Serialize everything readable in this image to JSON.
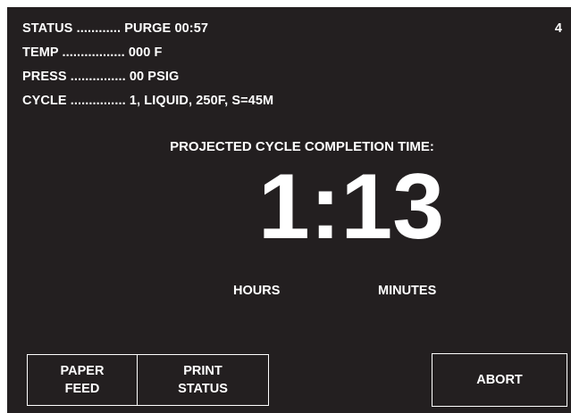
{
  "status_lines": {
    "status": "STATUS ............ PURGE 00:57",
    "temp": "TEMP ................. 000 F",
    "press": "PRESS ............... 00 PSIG",
    "cycle": "CYCLE ............... 1, LIQUID, 250F, S=45M"
  },
  "page_indicator": "4",
  "projection": {
    "label": "PROJECTED CYCLE COMPLETION TIME:",
    "time": "1:13",
    "hours_label": "HOURS",
    "minutes_label": "MINUTES"
  },
  "buttons": {
    "paper_feed": [
      "PAPER",
      "FEED"
    ],
    "print_status": [
      "PRINT",
      "STATUS"
    ],
    "abort": "ABORT"
  },
  "colors": {
    "screen_background": "#231f20",
    "text": "#ffffff",
    "page_background": "#ffffff"
  }
}
